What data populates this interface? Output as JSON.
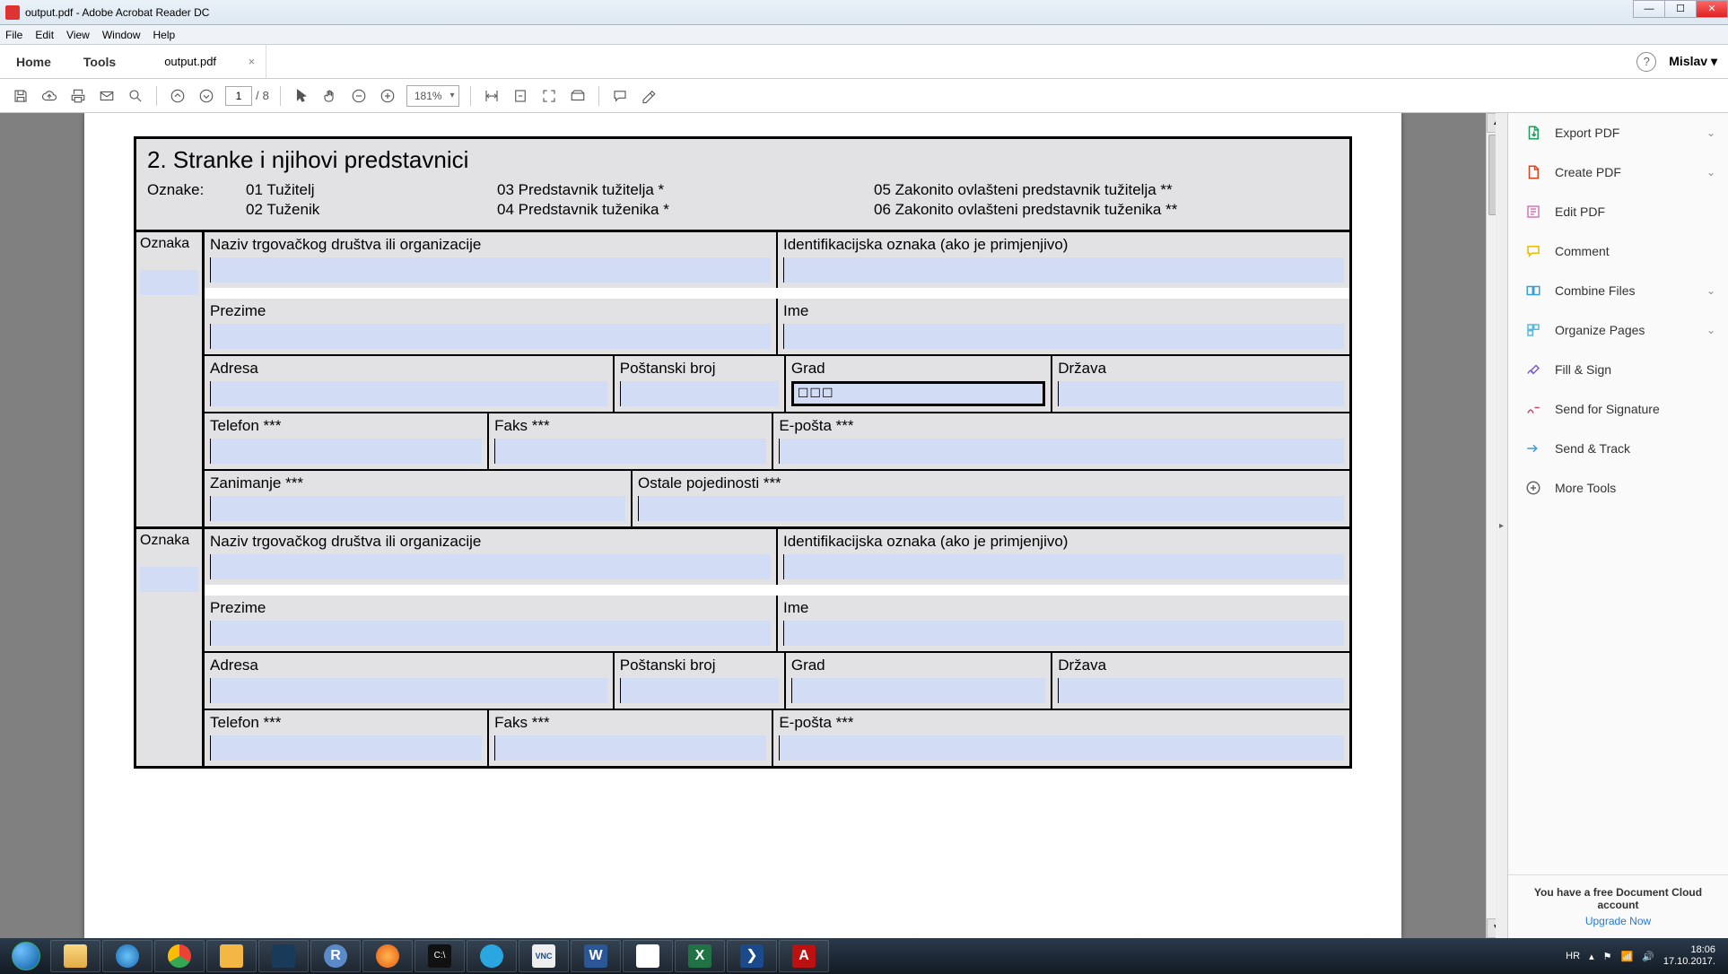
{
  "titlebar": {
    "title": "output.pdf - Adobe Acrobat Reader DC"
  },
  "menubar": {
    "items": [
      "File",
      "Edit",
      "View",
      "Window",
      "Help"
    ]
  },
  "tabs": {
    "home": "Home",
    "tools": "Tools",
    "file": "output.pdf",
    "user": "Mislav"
  },
  "toolbar": {
    "page_current": "1",
    "page_total": "8",
    "zoom": "181%"
  },
  "rail": {
    "items": [
      {
        "label": "Export PDF",
        "icon": "export",
        "chev": true
      },
      {
        "label": "Create PDF",
        "icon": "create",
        "chev": true
      },
      {
        "label": "Edit PDF",
        "icon": "edit",
        "chev": false
      },
      {
        "label": "Comment",
        "icon": "comment",
        "chev": false
      },
      {
        "label": "Combine Files",
        "icon": "combine",
        "chev": true
      },
      {
        "label": "Organize Pages",
        "icon": "organize",
        "chev": true
      },
      {
        "label": "Fill & Sign",
        "icon": "sign",
        "chev": false
      },
      {
        "label": "Send for Signature",
        "icon": "sendSig",
        "chev": false
      },
      {
        "label": "Send & Track",
        "icon": "track",
        "chev": false
      },
      {
        "label": "More Tools",
        "icon": "more",
        "chev": false
      }
    ],
    "promo_line": "You have a free Document Cloud account",
    "promo_link": "Upgrade Now"
  },
  "form": {
    "section_title": "2. Stranke i njihovi predstavnici",
    "legend_label": "Oznake:",
    "legend": {
      "r1c1": "01 Tužitelj",
      "r1c2": "03 Predstavnik tužitelja *",
      "r1c3": "05 Zakonito ovlašteni predstavnik tužitelja **",
      "r2c1": "02 Tuženik",
      "r2c2": "04 Predstavnik tuženika *",
      "r2c3": "06 Zakonito ovlašteni predstavnik tuženika **"
    },
    "labels": {
      "oznaka": "Oznaka",
      "naziv": "Naziv trgovačkog društva ili organizacije",
      "id": "Identifikacijska oznaka (ako je primjenjivo)",
      "prezime": "Prezime",
      "ime": "Ime",
      "adresa": "Adresa",
      "postanski": "Poštanski broj",
      "grad": "Grad",
      "drzava": "Država",
      "telefon": "Telefon ***",
      "faks": "Faks ***",
      "eposta": "E-pošta ***",
      "zanimanje": "Zanimanje ***",
      "ostalo": "Ostale pojedinosti ***"
    },
    "grad_focus": "☐☐☐"
  },
  "taskbar": {
    "lang": "HR",
    "time": "18:06",
    "date": "17.10.2017."
  }
}
